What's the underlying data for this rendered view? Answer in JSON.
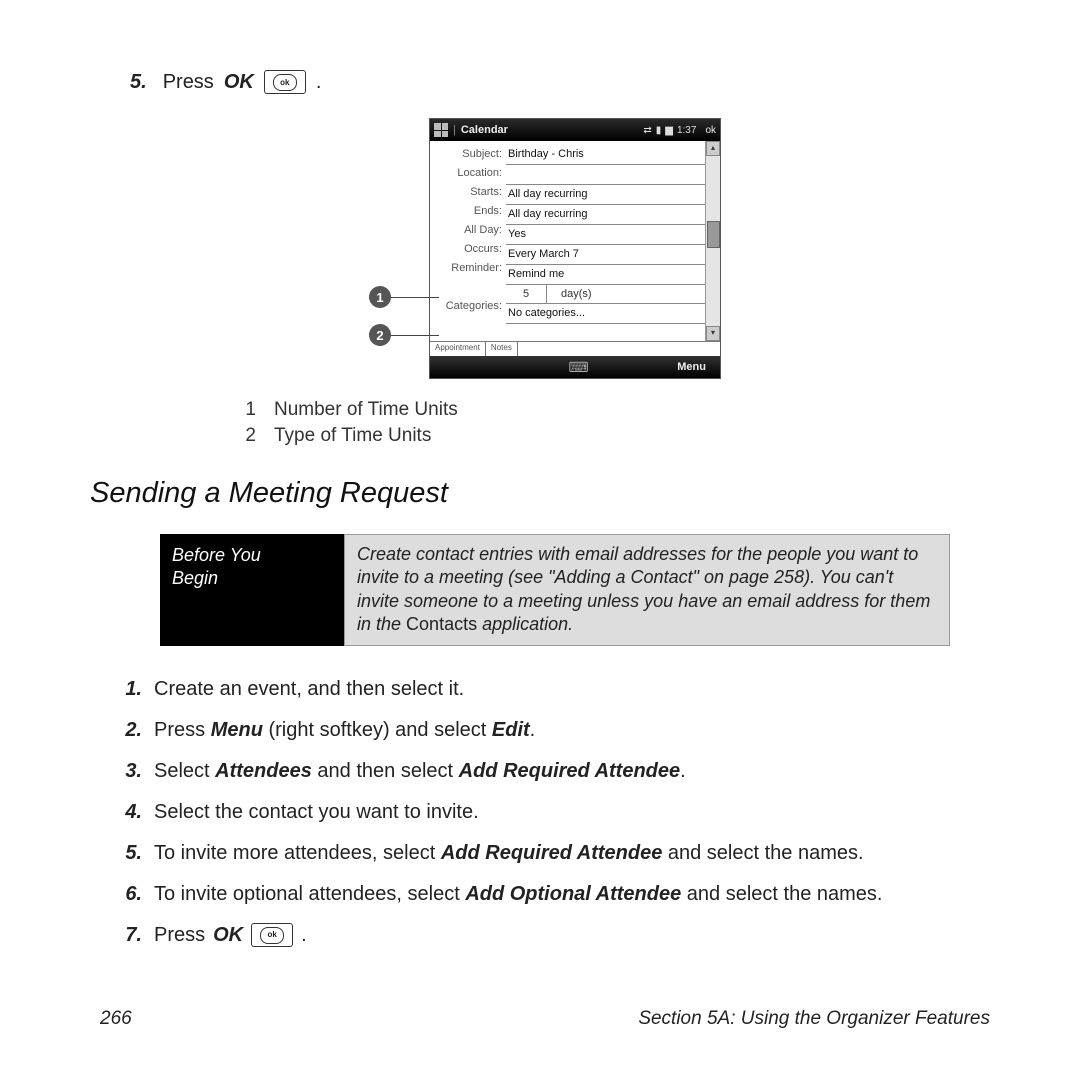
{
  "topStep": {
    "num": "5.",
    "press": "Press",
    "ok": "OK",
    "period": "."
  },
  "phone": {
    "title": "Calendar",
    "time": "1:37",
    "ok": "ok",
    "labels": {
      "subject": "Subject:",
      "location": "Location:",
      "starts": "Starts:",
      "ends": "Ends:",
      "allday": "All Day:",
      "occurs": "Occurs:",
      "reminder": "Reminder:",
      "categories": "Categories:"
    },
    "values": {
      "subject": "Birthday - Chris",
      "location": "",
      "starts": "All day recurring",
      "ends": "All day recurring",
      "allday": "Yes",
      "occurs": "Every March 7",
      "reminder": "Remind me",
      "reminder_num": "5",
      "reminder_unit": "day(s)",
      "categories": "No categories..."
    },
    "tabs": {
      "a": "Appointment",
      "b": "Notes"
    },
    "softMenu": "Menu",
    "scrollUp": "▴",
    "scrollDown": "▾",
    "kbIcon": "⌨"
  },
  "callouts": {
    "c1": "1",
    "c2": "2"
  },
  "legend": {
    "l1n": "1",
    "l1t": "Number of Time Units",
    "l2n": "2",
    "l2t": "Type of Time Units"
  },
  "heading": "Sending a Meeting Request",
  "byb": {
    "left1": "Before You",
    "left2": "Begin",
    "right_a": "Create contact entries with email addresses for the people you want to invite to a meeting (see \"Adding a Contact\" on page 258). You can't invite someone to a meeting unless you have an email address for them in the ",
    "right_b": "Contacts",
    "right_c": " application."
  },
  "steps": {
    "s1n": "1.",
    "s1t": "Create an event, and then select it.",
    "s2n": "2.",
    "s2a": "Press ",
    "s2b": "Menu",
    "s2c": " (right softkey) and select ",
    "s2d": "Edit",
    "s2e": ".",
    "s3n": "3.",
    "s3a": "Select ",
    "s3b": "Attendees",
    "s3c": " and then select ",
    "s3d": "Add Required Attendee",
    "s3e": ".",
    "s4n": "4.",
    "s4t": "Select the contact you want to invite.",
    "s5n": "5.",
    "s5a": "To invite more attendees, select ",
    "s5b": "Add Required Attendee",
    "s5c": " and select the names.",
    "s6n": "6.",
    "s6a": "To invite optional attendees, select ",
    "s6b": "Add Optional Attendee",
    "s6c": " and select the names.",
    "s7n": "7.",
    "s7a": "Press ",
    "s7b": "OK",
    "s7c": "."
  },
  "footer": {
    "page": "266",
    "section": "Section 5A: Using the Organizer Features"
  },
  "ok_inner": "ok"
}
